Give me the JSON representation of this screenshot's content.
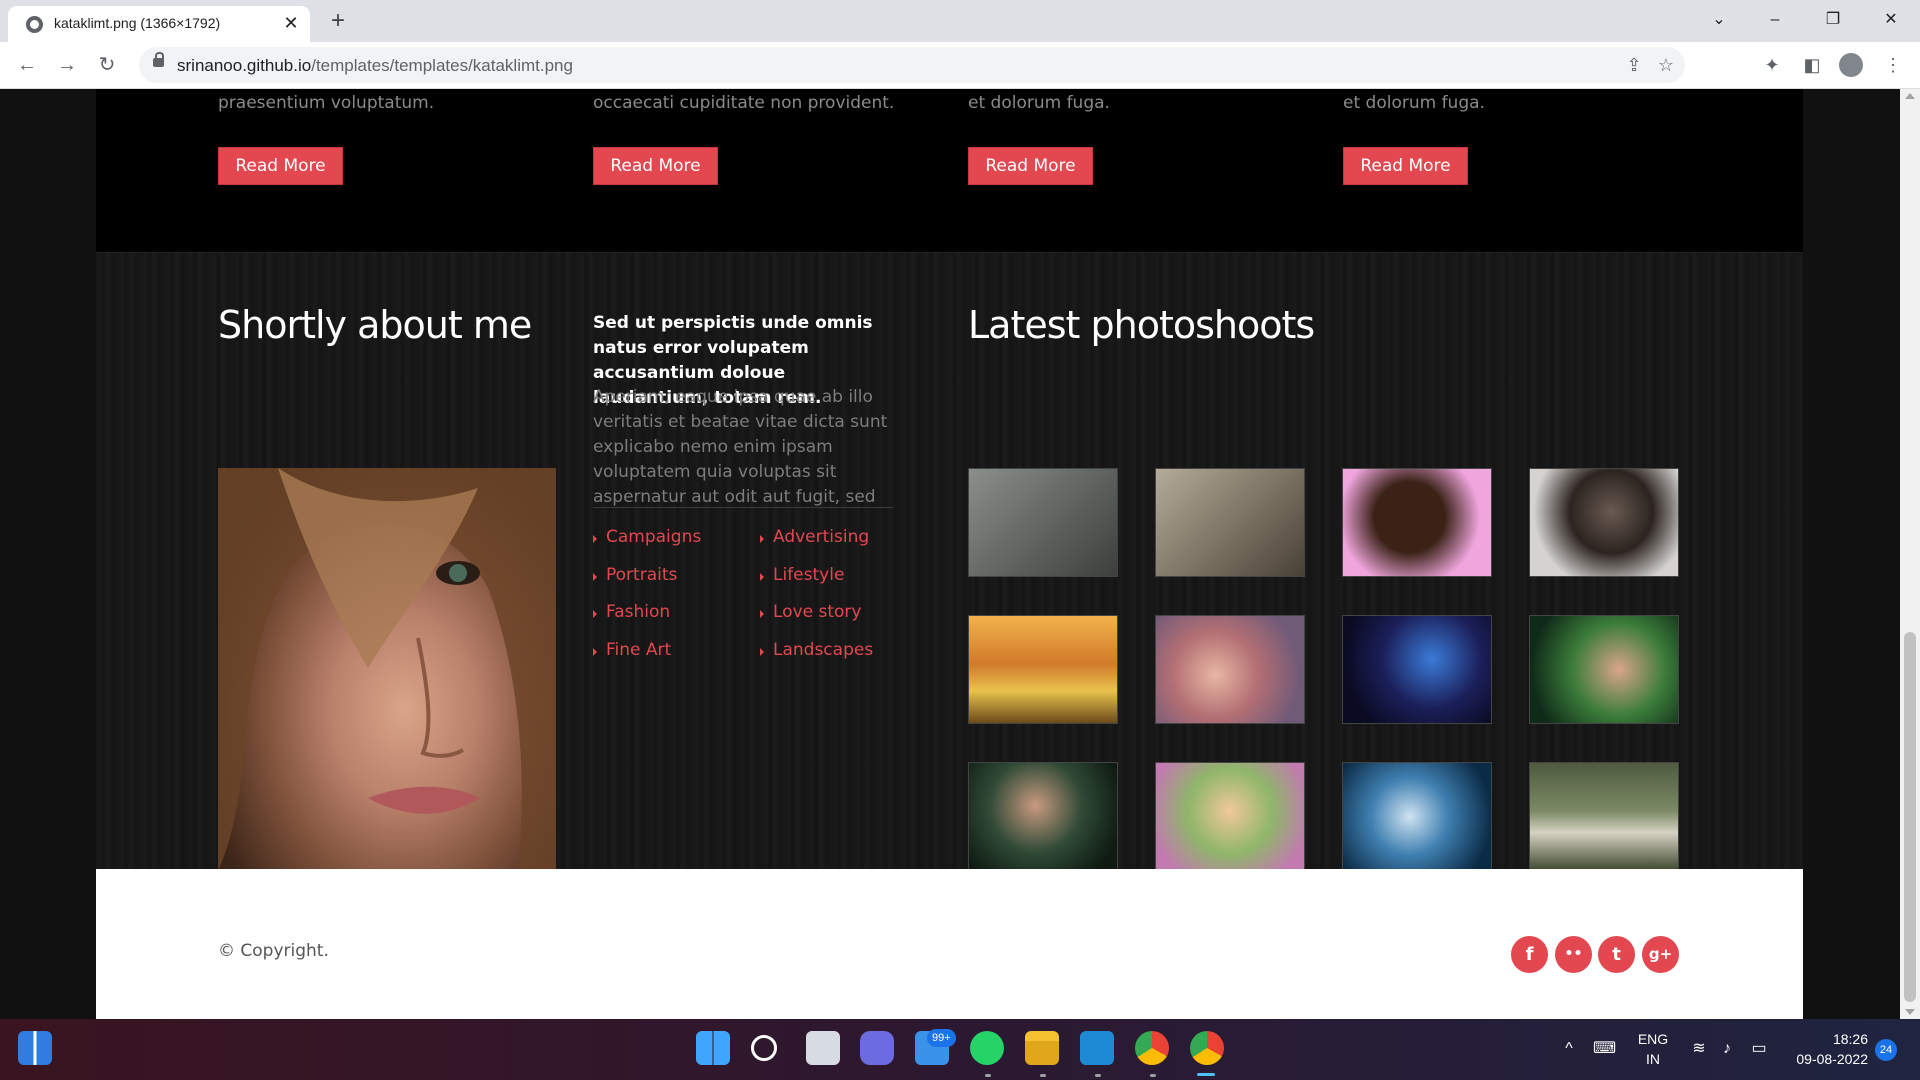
{
  "browser": {
    "tab_title": "kataklimt.png (1366×1792)",
    "tab_close": "✕",
    "new_tab": "+",
    "url_host": "srinanoo.github.io",
    "url_path": "/templates/templates/kataklimt.png",
    "nav": {
      "back": "←",
      "forward": "→",
      "reload": "↻"
    },
    "window": {
      "chevron": "⌄",
      "minimize": "–",
      "restore": "❐",
      "close": "✕"
    },
    "omnibox_icons": {
      "share": "⇪",
      "bookmark": "☆"
    },
    "toolbar_icons": {
      "extensions": "✦",
      "sidepanel": "◧",
      "menu": "⋮"
    }
  },
  "services": [
    {
      "text": "praesentium voluptatum.",
      "button": "Read More"
    },
    {
      "text": "occaecati cupiditate non provident.",
      "button": "Read More"
    },
    {
      "text": "et dolorum fuga.",
      "button": "Read More"
    },
    {
      "text": "et dolorum fuga.",
      "button": "Read More"
    }
  ],
  "about": {
    "title": "Shortly about me",
    "lead": "Sed ut perspictis unde omnis natus error volupatem accusantium doloue laudantium, totam rem.",
    "body": "Aperiam, eaque ipsa quae ab illo veritatis et beatae vitae dicta sunt explicabo nemo enim ipsam voluptatem quia voluptas sit aspernatur aut odit aut fugit, sed",
    "categories_left": [
      "Campaigns",
      "Portraits",
      "Fashion",
      "Fine Art"
    ],
    "categories_right": [
      "Advertising",
      "Lifestyle",
      "Love story",
      "Landscapes"
    ]
  },
  "photoshoots": {
    "title": "Latest photoshoots",
    "count": 12
  },
  "footer": {
    "copyright": "© Copyright.",
    "social": [
      "f",
      "••",
      "t",
      "g+"
    ],
    "social_names": [
      "facebook-icon",
      "flickr-icon",
      "twitter-icon",
      "google-plus-icon"
    ]
  },
  "taskbar": {
    "mail_badge": "99+",
    "lang_top": "ENG",
    "lang_bottom": "IN",
    "time": "18:26",
    "date": "09-08-2022",
    "notifications": "24",
    "sys_icons": {
      "chevron": "^",
      "keyboard": "⌨",
      "wifi": "≋",
      "volume": "♪",
      "battery": "▭"
    }
  },
  "colors": {
    "accent": "#e3474f",
    "page_dark": "#000000",
    "about_bg": "#171717",
    "footer_bg": "#ffffff"
  }
}
